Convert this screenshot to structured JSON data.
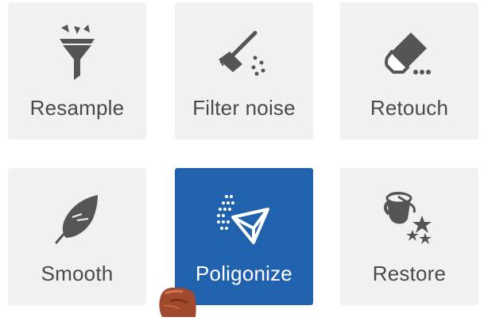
{
  "tools": [
    {
      "label": "Resample",
      "icon": "funnel-icon",
      "active": false
    },
    {
      "label": "Filter noise",
      "icon": "broom-icon",
      "active": false
    },
    {
      "label": "Retouch",
      "icon": "eraser-icon",
      "active": false
    },
    {
      "label": "Smooth",
      "icon": "feather-icon",
      "active": false
    },
    {
      "label": "Poligonize",
      "icon": "polygon-mesh-icon",
      "active": true
    },
    {
      "label": "Restore",
      "icon": "paint-bucket-stars-icon",
      "active": false
    }
  ],
  "colors": {
    "tile_bg": "#f1f1f1",
    "active_bg": "#2062ad",
    "icon": "#555555",
    "label": "#4a4a4a",
    "active_fg": "#ffffff"
  }
}
